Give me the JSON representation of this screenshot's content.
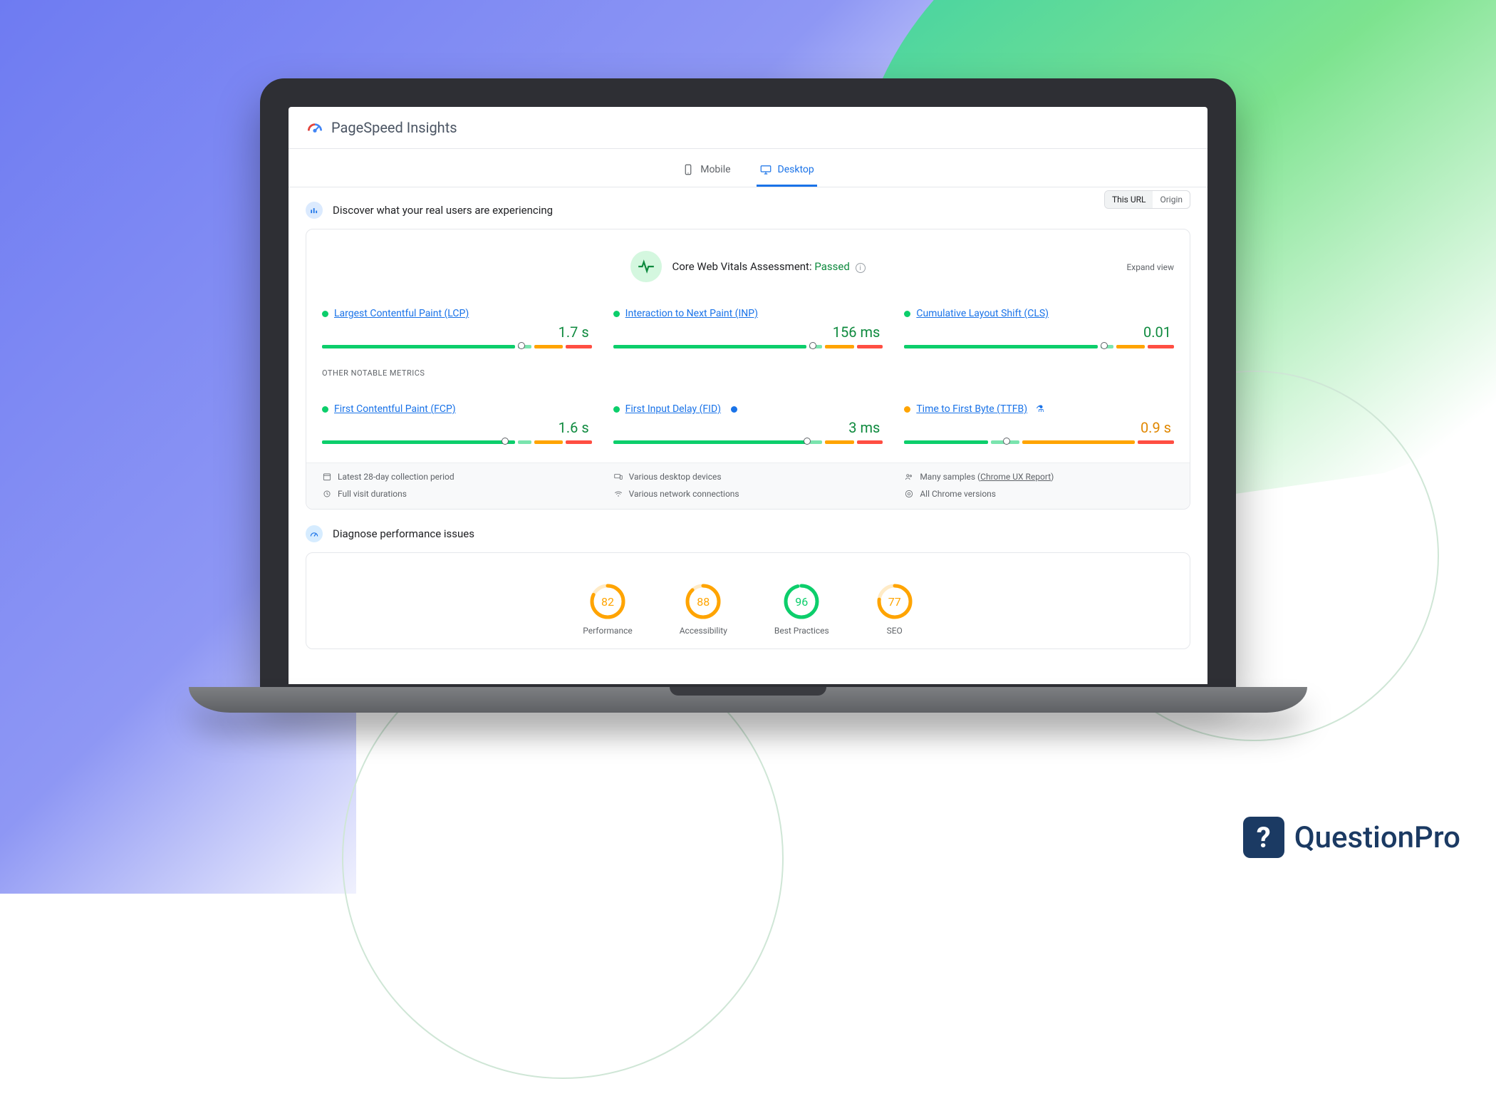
{
  "brand": {
    "name": "QuestionPro"
  },
  "app": {
    "title": "PageSpeed Insights"
  },
  "tabs": {
    "mobile": "Mobile",
    "desktop": "Desktop"
  },
  "discover": {
    "heading": "Discover what your real users are experiencing",
    "scope": {
      "this_url": "This URL",
      "origin": "Origin"
    }
  },
  "cwv": {
    "label": "Core Web Vitals Assessment:",
    "status": "Passed",
    "expand": "Expand view"
  },
  "metrics_core": [
    {
      "name": "Largest Contentful Paint (LCP)",
      "value": "1.7 s",
      "value_color": "green",
      "dot": "green",
      "segments": [
        74,
        5,
        11,
        10
      ],
      "marker": 74
    },
    {
      "name": "Interaction to Next Paint (INP)",
      "value": "156 ms",
      "value_color": "green",
      "dot": "green",
      "segments": [
        74,
        5,
        11,
        10
      ],
      "marker": 74
    },
    {
      "name": "Cumulative Layout Shift (CLS)",
      "value": "0.01",
      "value_color": "green",
      "dot": "green",
      "segments": [
        74,
        5,
        11,
        10
      ],
      "marker": 74
    }
  ],
  "other_label": "OTHER NOTABLE METRICS",
  "metrics_other": [
    {
      "name": "First Contentful Paint (FCP)",
      "value": "1.6 s",
      "value_color": "green",
      "dot": "green",
      "segments": [
        74,
        5,
        11,
        10
      ],
      "marker": 68,
      "extras": []
    },
    {
      "name": "First Input Delay (FID)",
      "value": "3 ms",
      "value_color": "green",
      "dot": "green",
      "segments": [
        74,
        5,
        11,
        10
      ],
      "marker": 72,
      "extras": [
        "info"
      ]
    },
    {
      "name": "Time to First Byte (TTFB)",
      "value": "0.9 s",
      "value_color": "orange",
      "dot": "orange",
      "segments": [
        32,
        11,
        43,
        14
      ],
      "marker": 38,
      "extras": [
        "flask"
      ]
    }
  ],
  "footer": {
    "a": "Latest 28-day collection period",
    "b": "Various desktop devices",
    "c_prefix": "Many samples (",
    "c_link": "Chrome UX Report",
    "c_suffix": ")",
    "d": "Full visit durations",
    "e": "Various network connections",
    "f": "All Chrome versions"
  },
  "diagnose": {
    "heading": "Diagnose performance issues"
  },
  "scores": [
    {
      "value": 82,
      "label": "Performance",
      "color": "#ffa400"
    },
    {
      "value": 88,
      "label": "Accessibility",
      "color": "#ffa400"
    },
    {
      "value": 96,
      "label": "Best Practices",
      "color": "#0cce6b"
    },
    {
      "value": 77,
      "label": "SEO",
      "color": "#ffa400"
    }
  ]
}
